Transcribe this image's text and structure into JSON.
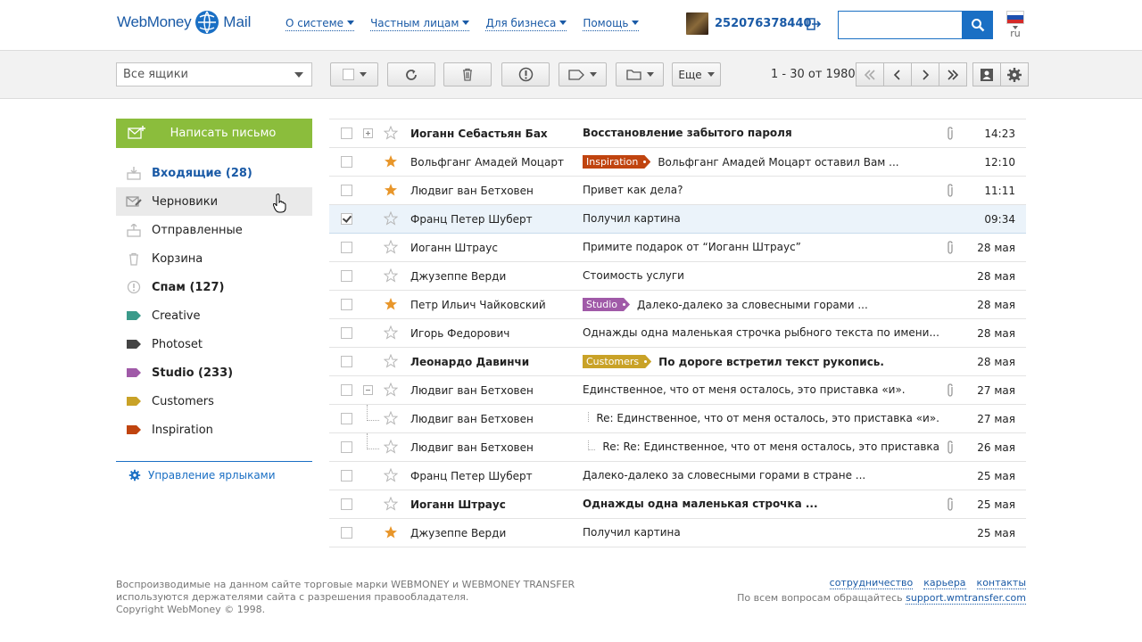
{
  "header": {
    "logo_text": "WebMoney",
    "logo_product": "Mail",
    "nav": [
      {
        "label": "О системе"
      },
      {
        "label": "Частным лицам"
      },
      {
        "label": "Для бизнеса"
      },
      {
        "label": "Помощь"
      }
    ],
    "wmid": "252076378440",
    "search_placeholder": "",
    "lang_code": "ru"
  },
  "toolbar": {
    "mailbox_select": "Все ящики",
    "more_label": "Еще",
    "pager_text": "1 - 30 от 1980"
  },
  "sidebar": {
    "compose_label": "Написать письмо",
    "folders": [
      {
        "label": "Входящие (28)",
        "icon": "inbox-icon"
      },
      {
        "label": "Черновики",
        "icon": "drafts-icon"
      },
      {
        "label": "Отправленные",
        "icon": "sent-icon"
      },
      {
        "label": "Корзина",
        "icon": "trash-icon"
      },
      {
        "label": "Спам (127)",
        "icon": "spam-icon"
      },
      {
        "label": "Creative",
        "icon": "label-icon",
        "color": "#3a9a8a"
      },
      {
        "label": "Photoset",
        "icon": "label-icon",
        "color": "#444444"
      },
      {
        "label": "Studio (233)",
        "icon": "label-icon",
        "color": "#a05aa8"
      },
      {
        "label": "Customers",
        "icon": "label-icon",
        "color": "#c9a227"
      },
      {
        "label": "Inspiration",
        "icon": "label-icon",
        "color": "#c0440f"
      }
    ],
    "manage_labels": "Управление ярлыками"
  },
  "tags": {
    "Inspiration": "#c0440f",
    "Studio": "#a05aa8",
    "Customers": "#c9a227"
  },
  "messages": [
    {
      "sender": "Иоганн Себастьян Бах",
      "subject": "Восстановление забытого пароля",
      "date": "14:23",
      "bold": true,
      "starred": false,
      "checked": false,
      "attach": true,
      "tag": "",
      "tree": "plus",
      "child": false
    },
    {
      "sender": "Вольфганг Амадей Моцарт",
      "subject": "Вольфганг Амадей Моцарт оставил Вам ...",
      "date": "12:10",
      "bold": false,
      "starred": true,
      "checked": false,
      "attach": false,
      "tag": "Inspiration",
      "tree": "",
      "child": false
    },
    {
      "sender": "Людвиг ван Бетховен",
      "subject": "Привет как дела?",
      "date": "11:11",
      "bold": false,
      "starred": true,
      "checked": false,
      "attach": true,
      "tag": "",
      "tree": "",
      "child": false
    },
    {
      "sender": "Франц Петер Шуберт",
      "subject": "Получил картина",
      "date": "09:34",
      "bold": false,
      "starred": false,
      "checked": true,
      "attach": false,
      "tag": "",
      "tree": "",
      "child": false
    },
    {
      "sender": "Иоганн Штраус",
      "subject": "Примите подарок от “Иоганн Штраус”",
      "date": "28 мая",
      "bold": false,
      "starred": false,
      "checked": false,
      "attach": true,
      "tag": "",
      "tree": "",
      "child": false
    },
    {
      "sender": "Джузеппе Верди",
      "subject": "Стоимость услуги",
      "date": "28 мая",
      "bold": false,
      "starred": false,
      "checked": false,
      "attach": false,
      "tag": "",
      "tree": "",
      "child": false
    },
    {
      "sender": "Петр Ильич Чайковский",
      "subject": "Далеко-далеко за словесными горами ...",
      "date": "28 мая",
      "bold": false,
      "starred": true,
      "checked": false,
      "attach": false,
      "tag": "Studio",
      "tree": "",
      "child": false
    },
    {
      "sender": "Игорь Федорович",
      "subject": "Однажды одна маленькая строчка рыбного текста по имени...",
      "date": "28 мая",
      "bold": false,
      "starred": false,
      "checked": false,
      "attach": false,
      "tag": "",
      "tree": "",
      "child": false
    },
    {
      "sender": "Леонардо Давинчи",
      "subject": "По дороге встретил текст рукопись.",
      "date": "28 мая",
      "bold": true,
      "starred": false,
      "checked": false,
      "attach": false,
      "tag": "Customers",
      "tree": "",
      "child": false
    },
    {
      "sender": "Людвиг ван Бетховен",
      "subject": "Единственное, что от меня осталось, это приставка «и».",
      "date": "27 мая",
      "bold": false,
      "starred": false,
      "checked": false,
      "attach": true,
      "tag": "",
      "tree": "minus",
      "child": false
    },
    {
      "sender": "Людвиг ван Бетховен",
      "subject": "Re: Единственное, что от меня осталось, это приставка «и».",
      "date": "27 мая",
      "bold": false,
      "starred": false,
      "checked": false,
      "attach": false,
      "tag": "",
      "tree": "",
      "child": true
    },
    {
      "sender": "Людвиг ван Бетховен",
      "subject": "Re: Re: Единственное, что от меня осталось, это приставка",
      "date": "26 мая",
      "bold": false,
      "starred": false,
      "checked": false,
      "attach": true,
      "tag": "",
      "tree": "",
      "child": true
    },
    {
      "sender": "Франц Петер Шуберт",
      "subject": "Далеко-далеко за словесными горами в стране ...",
      "date": "25 мая",
      "bold": false,
      "starred": false,
      "checked": false,
      "attach": false,
      "tag": "",
      "tree": "",
      "child": false
    },
    {
      "sender": "Иоганн Штраус",
      "subject": "Однажды одна маленькая строчка ...",
      "date": "25 мая",
      "bold": true,
      "starred": false,
      "checked": false,
      "attach": true,
      "tag": "",
      "tree": "",
      "child": false
    },
    {
      "sender": "Джузеппе Верди",
      "subject": "Получил картина",
      "date": "25 мая",
      "bold": false,
      "starred": true,
      "checked": false,
      "attach": false,
      "tag": "",
      "tree": "",
      "child": false
    }
  ],
  "footer": {
    "line1": "Воспроизводимые на данном сайте торговые марки WEBMONEY и WEBMONEY TRANSFER",
    "line2": "используются держателями сайта с разрешения правообладателя.",
    "line3": "Copyright WebMoney © 1998.",
    "links": [
      "сотрудничество",
      "карьера",
      "контакты"
    ],
    "support_text": "По всем вопросам обращайтесь",
    "support_link": "support.wmtransfer.com"
  },
  "colors": {
    "accent": "#1a5aa6",
    "compose": "#8bbd3c",
    "star_on": "#e8962a"
  }
}
